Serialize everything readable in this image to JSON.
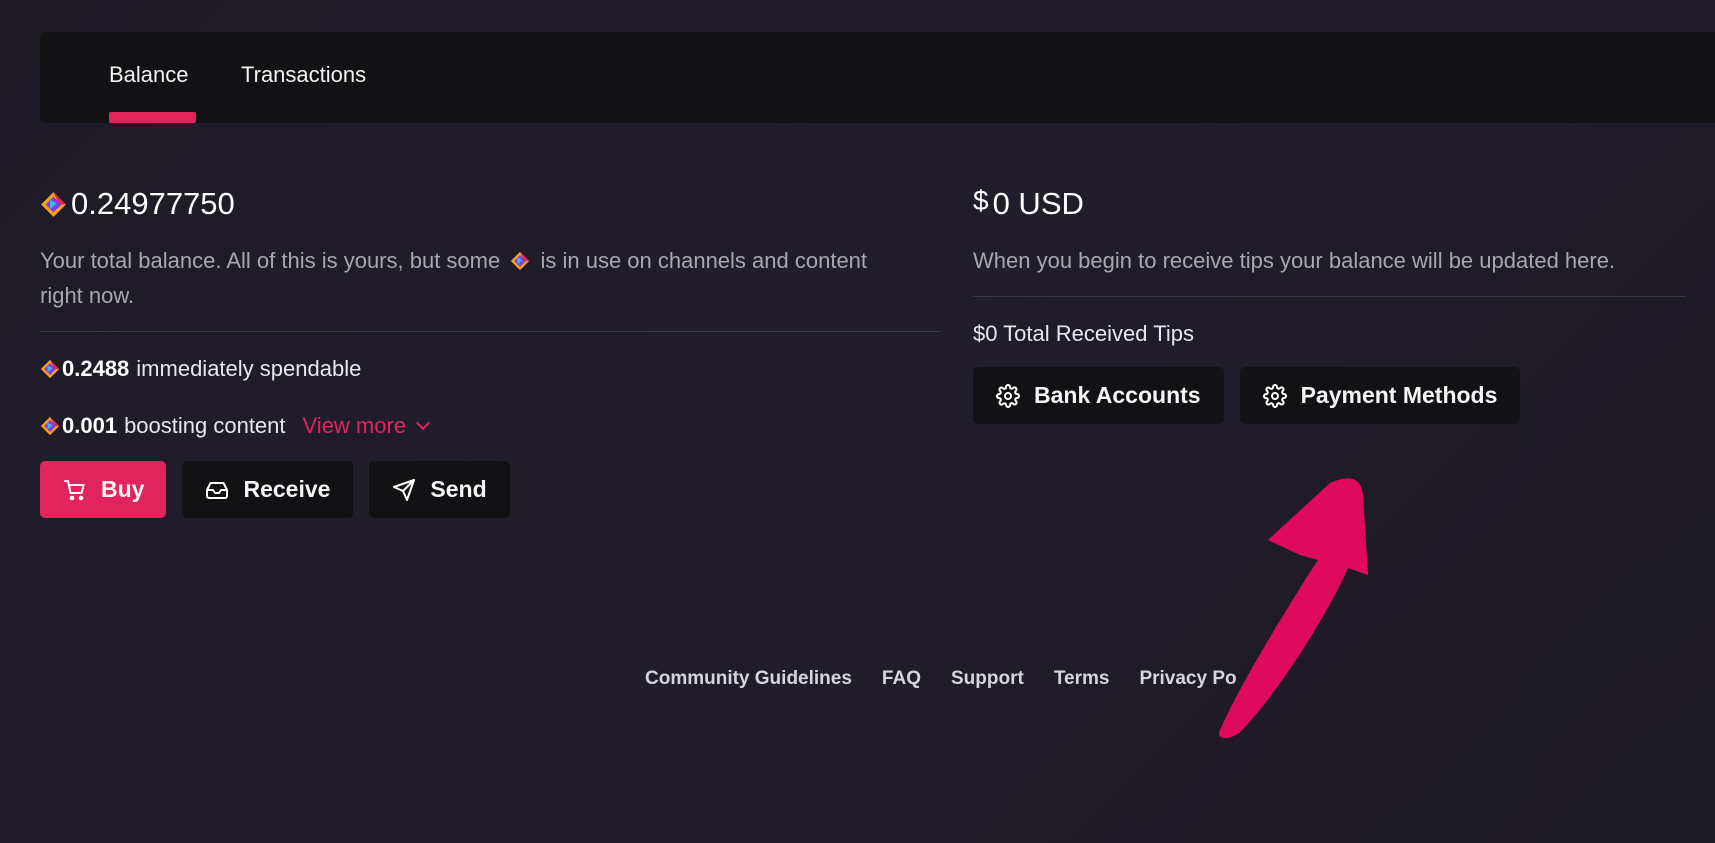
{
  "tabs": [
    {
      "label": "Balance",
      "active": true
    },
    {
      "label": "Transactions",
      "active": false
    }
  ],
  "credits": {
    "total": "0.24977750",
    "description_part1": "Your total balance. All of this is yours, but some",
    "description_part2": "is in use on channels and content right now.",
    "spendable_value": "0.2488",
    "spendable_label": "immediately spendable",
    "boosting_value": "0.001",
    "boosting_label": "boosting content",
    "view_more_label": "View more",
    "buttons": {
      "buy": "Buy",
      "receive": "Receive",
      "send": "Send"
    }
  },
  "usd": {
    "currency_symbol": "$",
    "total": "0 USD",
    "description": "When you begin to receive tips your balance will be updated here.",
    "tips_label": "$0 Total Received Tips",
    "buttons": {
      "bank_accounts": "Bank Accounts",
      "payment_methods": "Payment Methods"
    }
  },
  "footer": {
    "links": [
      "Community Guidelines",
      "FAQ",
      "Support",
      "Terms",
      "Privacy Po"
    ]
  },
  "colors": {
    "accent": "#e0245e",
    "panel": "#121214",
    "background": "#1f1c26",
    "muted_text": "#a8a7ae"
  },
  "icons": {
    "credit": "lbc-credit-icon",
    "cart": "cart-icon",
    "inbox": "inbox-icon",
    "send": "send-icon",
    "gear": "gear-icon",
    "chevron": "chevron-down-icon",
    "arrow": "annotation-arrow"
  }
}
